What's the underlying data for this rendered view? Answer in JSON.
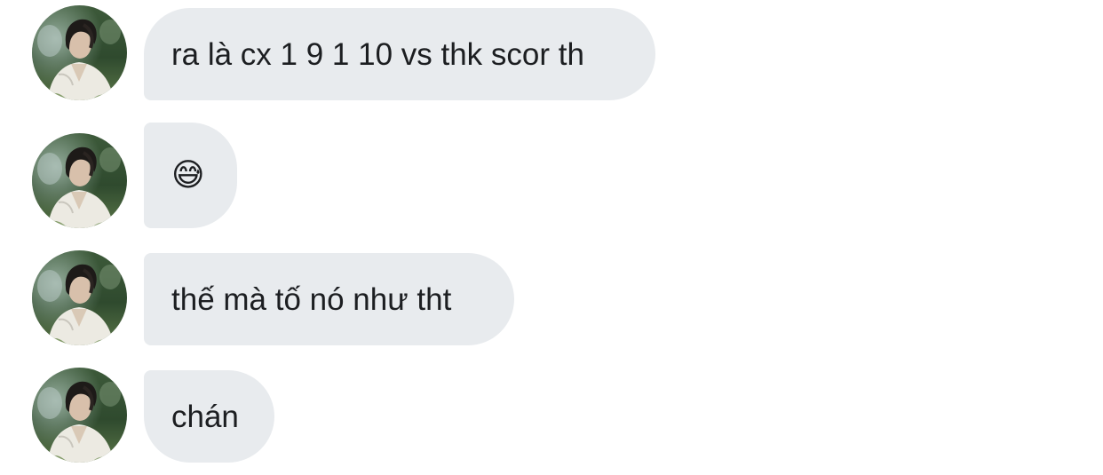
{
  "messages": [
    {
      "text": "ra là cx 1 9 1 10 vs thk scor th"
    },
    {
      "text": "😅"
    },
    {
      "text": "thế mà tố nó như tht"
    },
    {
      "text": "chán"
    }
  ],
  "colors": {
    "bubble_bg": "#e8ebee",
    "text": "#1c1e21"
  },
  "avatar": {
    "icon": "avatar"
  }
}
